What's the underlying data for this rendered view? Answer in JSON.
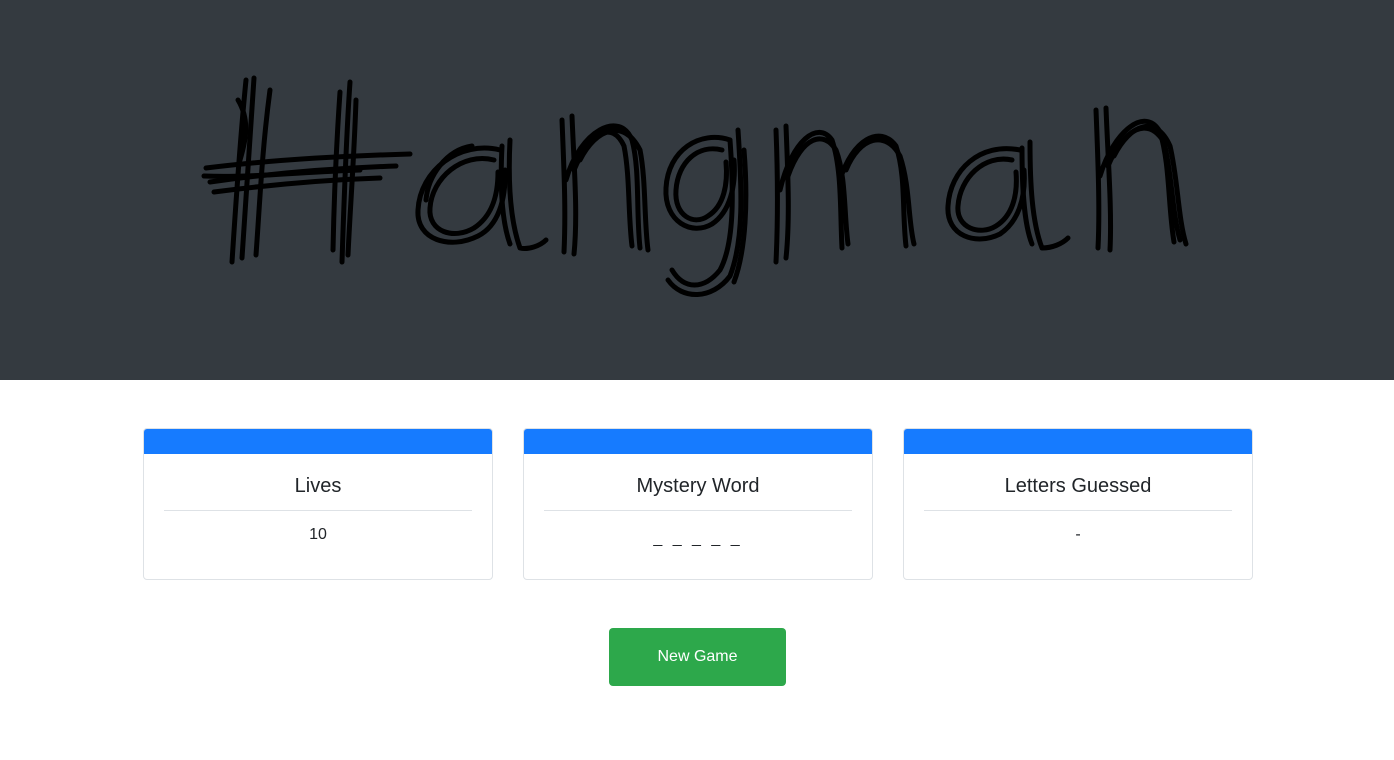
{
  "header": {
    "logo_text": "Hangman",
    "background_color": "#343a40"
  },
  "cards": [
    {
      "title": "Lives",
      "value": "10"
    },
    {
      "title": "Mystery Word",
      "value": "_ _ _ _ _"
    },
    {
      "title": "Letters Guessed",
      "value": "-"
    }
  ],
  "accent_color": "#167bff",
  "actions": {
    "new_game_label": "New Game",
    "new_game_color": "#2da84b"
  }
}
